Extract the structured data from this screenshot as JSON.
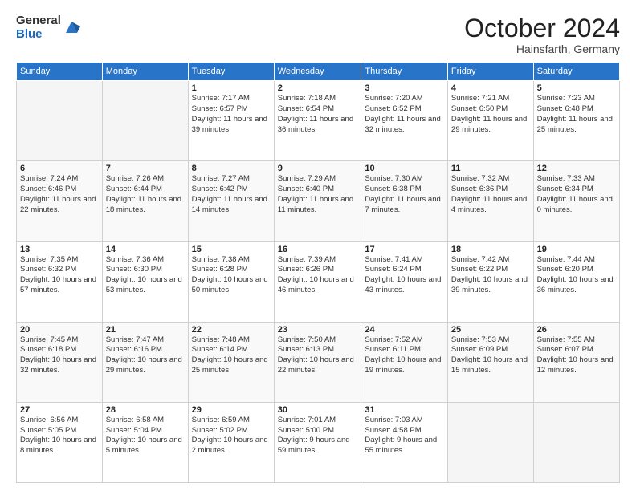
{
  "header": {
    "logo_general": "General",
    "logo_blue": "Blue",
    "month_title": "October 2024",
    "location": "Hainsfarth, Germany"
  },
  "weekdays": [
    "Sunday",
    "Monday",
    "Tuesday",
    "Wednesday",
    "Thursday",
    "Friday",
    "Saturday"
  ],
  "weeks": [
    [
      {
        "day": "",
        "info": ""
      },
      {
        "day": "",
        "info": ""
      },
      {
        "day": "1",
        "info": "Sunrise: 7:17 AM\nSunset: 6:57 PM\nDaylight: 11 hours and 39 minutes."
      },
      {
        "day": "2",
        "info": "Sunrise: 7:18 AM\nSunset: 6:54 PM\nDaylight: 11 hours and 36 minutes."
      },
      {
        "day": "3",
        "info": "Sunrise: 7:20 AM\nSunset: 6:52 PM\nDaylight: 11 hours and 32 minutes."
      },
      {
        "day": "4",
        "info": "Sunrise: 7:21 AM\nSunset: 6:50 PM\nDaylight: 11 hours and 29 minutes."
      },
      {
        "day": "5",
        "info": "Sunrise: 7:23 AM\nSunset: 6:48 PM\nDaylight: 11 hours and 25 minutes."
      }
    ],
    [
      {
        "day": "6",
        "info": "Sunrise: 7:24 AM\nSunset: 6:46 PM\nDaylight: 11 hours and 22 minutes."
      },
      {
        "day": "7",
        "info": "Sunrise: 7:26 AM\nSunset: 6:44 PM\nDaylight: 11 hours and 18 minutes."
      },
      {
        "day": "8",
        "info": "Sunrise: 7:27 AM\nSunset: 6:42 PM\nDaylight: 11 hours and 14 minutes."
      },
      {
        "day": "9",
        "info": "Sunrise: 7:29 AM\nSunset: 6:40 PM\nDaylight: 11 hours and 11 minutes."
      },
      {
        "day": "10",
        "info": "Sunrise: 7:30 AM\nSunset: 6:38 PM\nDaylight: 11 hours and 7 minutes."
      },
      {
        "day": "11",
        "info": "Sunrise: 7:32 AM\nSunset: 6:36 PM\nDaylight: 11 hours and 4 minutes."
      },
      {
        "day": "12",
        "info": "Sunrise: 7:33 AM\nSunset: 6:34 PM\nDaylight: 11 hours and 0 minutes."
      }
    ],
    [
      {
        "day": "13",
        "info": "Sunrise: 7:35 AM\nSunset: 6:32 PM\nDaylight: 10 hours and 57 minutes."
      },
      {
        "day": "14",
        "info": "Sunrise: 7:36 AM\nSunset: 6:30 PM\nDaylight: 10 hours and 53 minutes."
      },
      {
        "day": "15",
        "info": "Sunrise: 7:38 AM\nSunset: 6:28 PM\nDaylight: 10 hours and 50 minutes."
      },
      {
        "day": "16",
        "info": "Sunrise: 7:39 AM\nSunset: 6:26 PM\nDaylight: 10 hours and 46 minutes."
      },
      {
        "day": "17",
        "info": "Sunrise: 7:41 AM\nSunset: 6:24 PM\nDaylight: 10 hours and 43 minutes."
      },
      {
        "day": "18",
        "info": "Sunrise: 7:42 AM\nSunset: 6:22 PM\nDaylight: 10 hours and 39 minutes."
      },
      {
        "day": "19",
        "info": "Sunrise: 7:44 AM\nSunset: 6:20 PM\nDaylight: 10 hours and 36 minutes."
      }
    ],
    [
      {
        "day": "20",
        "info": "Sunrise: 7:45 AM\nSunset: 6:18 PM\nDaylight: 10 hours and 32 minutes."
      },
      {
        "day": "21",
        "info": "Sunrise: 7:47 AM\nSunset: 6:16 PM\nDaylight: 10 hours and 29 minutes."
      },
      {
        "day": "22",
        "info": "Sunrise: 7:48 AM\nSunset: 6:14 PM\nDaylight: 10 hours and 25 minutes."
      },
      {
        "day": "23",
        "info": "Sunrise: 7:50 AM\nSunset: 6:13 PM\nDaylight: 10 hours and 22 minutes."
      },
      {
        "day": "24",
        "info": "Sunrise: 7:52 AM\nSunset: 6:11 PM\nDaylight: 10 hours and 19 minutes."
      },
      {
        "day": "25",
        "info": "Sunrise: 7:53 AM\nSunset: 6:09 PM\nDaylight: 10 hours and 15 minutes."
      },
      {
        "day": "26",
        "info": "Sunrise: 7:55 AM\nSunset: 6:07 PM\nDaylight: 10 hours and 12 minutes."
      }
    ],
    [
      {
        "day": "27",
        "info": "Sunrise: 6:56 AM\nSunset: 5:05 PM\nDaylight: 10 hours and 8 minutes."
      },
      {
        "day": "28",
        "info": "Sunrise: 6:58 AM\nSunset: 5:04 PM\nDaylight: 10 hours and 5 minutes."
      },
      {
        "day": "29",
        "info": "Sunrise: 6:59 AM\nSunset: 5:02 PM\nDaylight: 10 hours and 2 minutes."
      },
      {
        "day": "30",
        "info": "Sunrise: 7:01 AM\nSunset: 5:00 PM\nDaylight: 9 hours and 59 minutes."
      },
      {
        "day": "31",
        "info": "Sunrise: 7:03 AM\nSunset: 4:58 PM\nDaylight: 9 hours and 55 minutes."
      },
      {
        "day": "",
        "info": ""
      },
      {
        "day": "",
        "info": ""
      }
    ]
  ]
}
